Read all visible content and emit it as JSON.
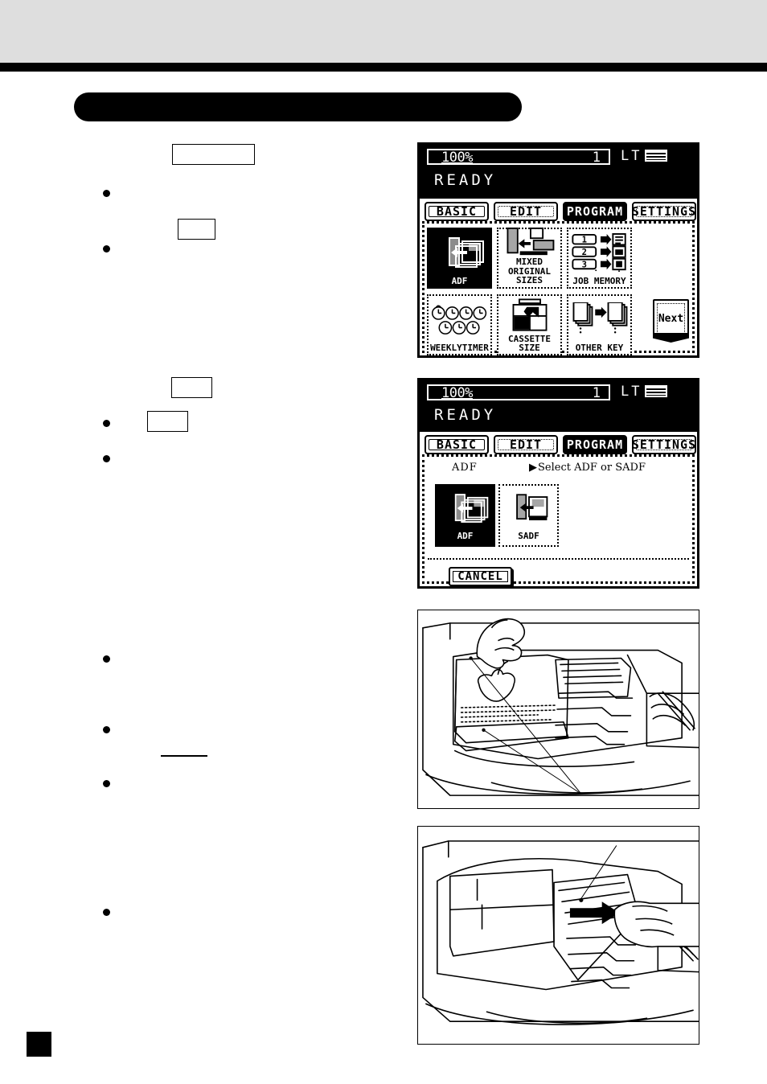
{
  "page": {
    "title_banner": "",
    "page_number": ""
  },
  "left_column": {
    "steps": [
      {
        "label": ""
      },
      {
        "label": ""
      },
      {
        "label": ""
      },
      {
        "label": ""
      }
    ],
    "bullets": [
      "",
      "",
      "",
      "",
      "",
      "",
      ""
    ]
  },
  "panel1": {
    "status": {
      "zoom": "100%",
      "copies": "1",
      "paper_size": "LT",
      "paper_icon": "paper-stack-icon",
      "message": "READY"
    },
    "tabs": [
      {
        "label": "BASIC",
        "selected": false,
        "style": "solid"
      },
      {
        "label": "EDIT",
        "selected": false,
        "style": "dotted"
      },
      {
        "label": "PROGRAM",
        "selected": true,
        "style": "solid"
      },
      {
        "label": "SETTINGS",
        "selected": false,
        "style": "dotted"
      }
    ],
    "keys": [
      {
        "label": "ADF",
        "label2": "",
        "icon": "adf-icon",
        "selected": true
      },
      {
        "label": "MIXED",
        "label2": "ORIGINAL SIZES",
        "icon": "mixed-original-sizes-icon",
        "selected": false
      },
      {
        "label": "JOB MEMORY",
        "label2": "",
        "icon": "job-memory-icon",
        "selected": false
      },
      {
        "label": "WEEKLYTIMER",
        "label2": "",
        "icon": "weekly-timer-icon",
        "selected": false
      },
      {
        "label": "CASSETTE SIZE",
        "label2": "",
        "icon": "cassette-size-icon",
        "selected": false
      },
      {
        "label": "OTHER KEY",
        "label2": "",
        "icon": "other-key-icon",
        "selected": false
      }
    ],
    "job_memory_rows": [
      "1",
      "2",
      "3"
    ],
    "next_key": {
      "label": "Next"
    }
  },
  "panel2": {
    "status": {
      "zoom": "100%",
      "copies": "1",
      "paper_size": "LT",
      "paper_icon": "paper-stack-icon",
      "message": "READY"
    },
    "tabs": [
      {
        "label": "BASIC",
        "selected": false,
        "style": "solid"
      },
      {
        "label": "EDIT",
        "selected": false,
        "style": "dotted"
      },
      {
        "label": "PROGRAM",
        "selected": true,
        "style": "solid"
      },
      {
        "label": "SETTINGS",
        "selected": false,
        "style": "dotted"
      }
    ],
    "mode_label": "ADF",
    "hint": "Select ADF or SADF",
    "hint_arrow": "▶",
    "keys": [
      {
        "label": "ADF",
        "icon": "adf-icon",
        "selected": true
      },
      {
        "label": "SADF",
        "icon": "sadf-icon",
        "selected": false
      }
    ],
    "cancel": {
      "label": "CANCEL"
    }
  },
  "figures": [
    {
      "name": "adf-load-original-illustration",
      "caption": "",
      "callouts": [
        "",
        ""
      ]
    },
    {
      "name": "adf-align-side-guides-illustration",
      "caption": "",
      "callouts": [
        ""
      ]
    }
  ]
}
